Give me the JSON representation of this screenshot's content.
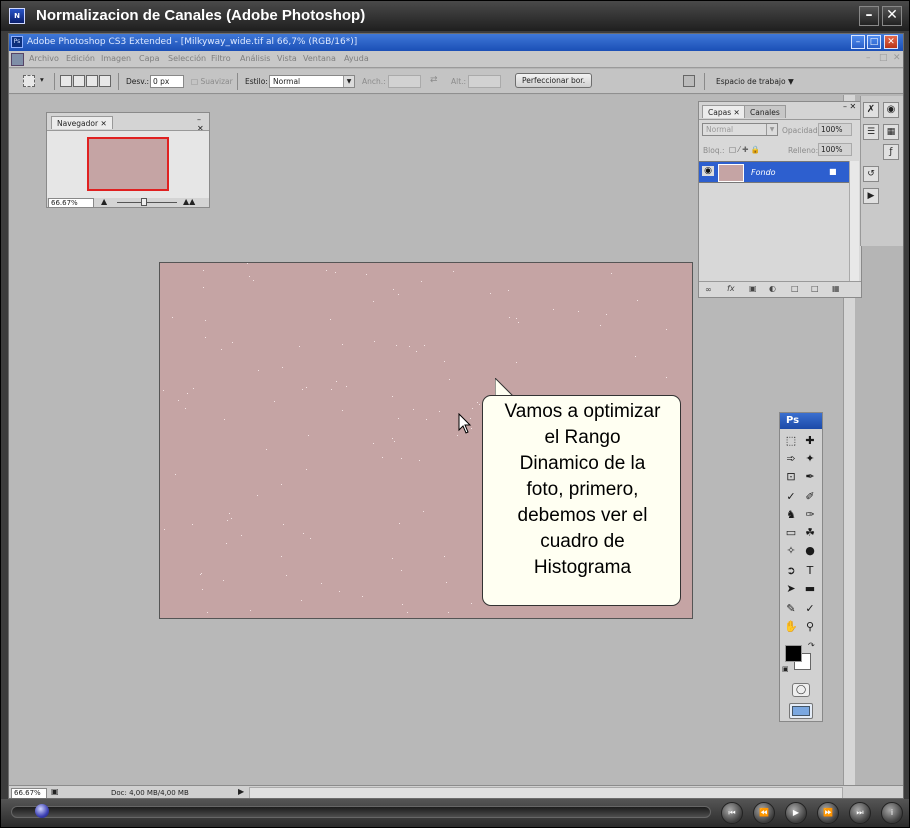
{
  "window": {
    "title": "Normalizacion de Canales  (Adobe Photoshop)",
    "minimize": "–",
    "close": "✕"
  },
  "photoshop": {
    "title": "Adobe Photoshop CS3 Extended - [Milkyway_wide.tif al 66,7% (RGB/16*)]",
    "menu": [
      "Archivo",
      "Edición",
      "Imagen",
      "Capa",
      "Selección",
      "Filtro",
      "Análisis",
      "Vista",
      "Ventana",
      "Ayuda"
    ]
  },
  "options": {
    "desv_label": "Desv.:",
    "desv_value": "0 px",
    "suavizar": "Suavizar",
    "estilo_label": "Estilo:",
    "estilo_value": "Normal",
    "anch_label": "Anch.:",
    "alt_label": "Alt.:",
    "refine_button": "Perfeccionar bor.",
    "workspace": "Espacio de trabajo"
  },
  "navigator": {
    "tab": "Navegador",
    "zoom": "66.67%"
  },
  "layers_panel": {
    "tabs": [
      "Capas",
      "Canales"
    ],
    "blend_mode": "Normal",
    "opacity_label": "Opacidad:",
    "opacity_value": "100%",
    "lock_label": "Bloq.:",
    "fill_label": "Relleno:",
    "fill_value": "100%",
    "layer_name": "Fondo"
  },
  "tools": {
    "header": "Ps"
  },
  "status": {
    "zoom": "66.67%",
    "doc": "Doc: 4,00 MB/4,00 MB"
  },
  "callout": {
    "lines": [
      "Vamos a optimizar",
      "el Rango",
      "Dinamico de la",
      "foto, primero,",
      "debemos ver el",
      "cuadro de",
      "Histograma"
    ]
  },
  "colors": {
    "photo_bg": "#c5a4a4",
    "title_blue": "#1b4fb6",
    "workspace_gray": "#b8b8b8"
  }
}
